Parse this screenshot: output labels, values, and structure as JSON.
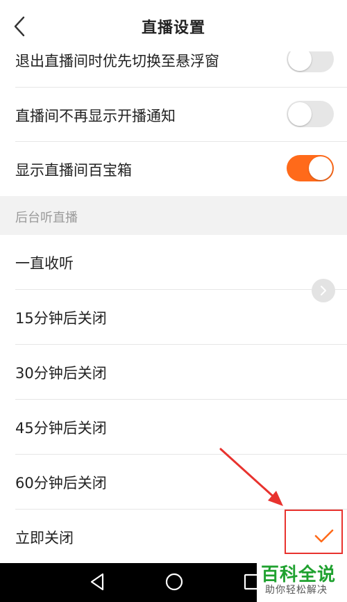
{
  "header": {
    "title": "直播设置",
    "back_icon": "chevron-left-icon"
  },
  "settings": {
    "toggles": [
      {
        "label": "退出直播间时优先切换至悬浮窗",
        "enabled": false
      },
      {
        "label": "直播间不再显示开播通知",
        "enabled": false
      },
      {
        "label": "显示直播间百宝箱",
        "enabled": true
      }
    ]
  },
  "background_listening": {
    "section_title": "后台听直播",
    "options": [
      {
        "label": "一直收听",
        "selected": false
      },
      {
        "label": "15分钟后关闭",
        "selected": false
      },
      {
        "label": "30分钟后关闭",
        "selected": false
      },
      {
        "label": "45分钟后关闭",
        "selected": false
      },
      {
        "label": "60分钟后关闭",
        "selected": false
      },
      {
        "label": "立即关闭",
        "selected": true
      }
    ]
  },
  "colors": {
    "accent": "#ff6a1a",
    "toggle_off": "#e6e6e6",
    "annotation": "#e8322e",
    "watermark": "#1fa12f"
  },
  "watermark": {
    "title": "百科全说",
    "subtitle": "助你轻松解决"
  },
  "navbar": {
    "icons": [
      "back-triangle-icon",
      "home-circle-icon",
      "recents-square-icon"
    ]
  }
}
